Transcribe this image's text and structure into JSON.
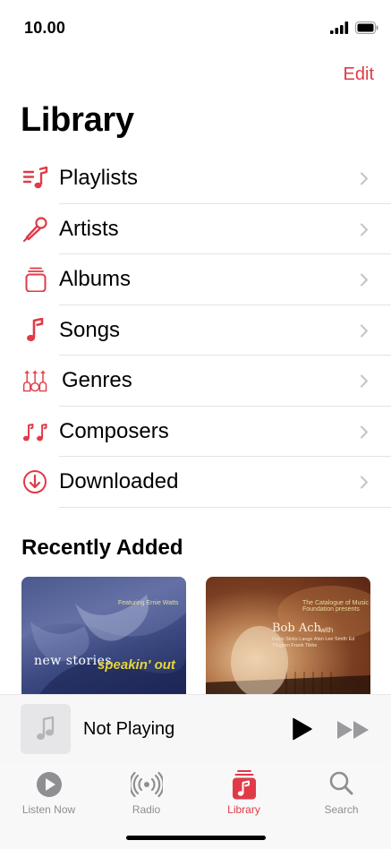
{
  "status_bar": {
    "time": "10.00"
  },
  "header": {
    "edit_label": "Edit",
    "title": "Library"
  },
  "library": {
    "items": [
      {
        "label": "Playlists",
        "icon": "playlist-icon"
      },
      {
        "label": "Artists",
        "icon": "microphone-icon"
      },
      {
        "label": "Albums",
        "icon": "album-stack-icon"
      },
      {
        "label": "Songs",
        "icon": "music-note-icon"
      },
      {
        "label": "Genres",
        "icon": "guitars-icon"
      },
      {
        "label": "Composers",
        "icon": "double-note-icon"
      },
      {
        "label": "Downloaded",
        "icon": "download-circle-icon"
      }
    ]
  },
  "recently_added": {
    "title": "Recently Added",
    "albums": [
      {
        "cover_text_main": "new stories",
        "cover_text_sub": "speakin' out",
        "cover_small": "Featuring Ernie Watts"
      },
      {
        "cover_small": "The Catalogue of Music Foundation presents",
        "cover_artist": "Bob Ach",
        "cover_with": "with",
        "cover_fine": "Davis Sinks Lange Alan Lee Smith Ed Thigpen Frank Tibbs"
      }
    ]
  },
  "mini_player": {
    "title": "Not Playing"
  },
  "tab_bar": {
    "tabs": [
      {
        "label": "Listen Now",
        "icon": "play-circle-icon",
        "active": false
      },
      {
        "label": "Radio",
        "icon": "radio-waves-icon",
        "active": false
      },
      {
        "label": "Library",
        "icon": "library-icon",
        "active": true
      },
      {
        "label": "Search",
        "icon": "search-icon",
        "active": false
      }
    ]
  },
  "colors": {
    "accent": "#e03a47",
    "inactive": "#8e8e93",
    "separator": "#e3e3e6"
  }
}
